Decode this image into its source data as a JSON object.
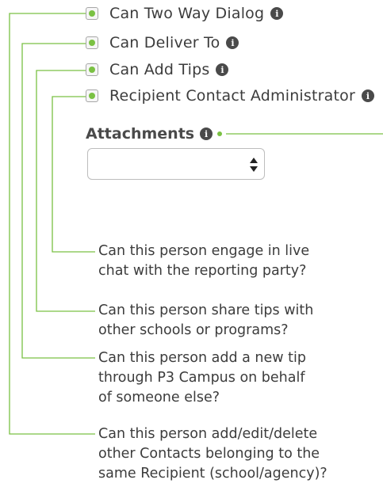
{
  "options": [
    {
      "label": "Can Two Way Dialog",
      "checked": true
    },
    {
      "label": "Can Deliver To",
      "checked": true
    },
    {
      "label": "Can Add Tips",
      "checked": true
    },
    {
      "label": "Recipient Contact Administrator",
      "checked": true
    }
  ],
  "attachments": {
    "label": "Attachments",
    "selected": ""
  },
  "notes": [
    {
      "lines": [
        "Can this person engage in live",
        "chat with the reporting party?"
      ]
    },
    {
      "lines": [
        "Can this person share tips with",
        "other schools or programs?"
      ]
    },
    {
      "lines": [
        "Can this person add a new tip",
        "through P3 Campus on behalf",
        "of someone else?"
      ]
    },
    {
      "lines": [
        "Can this person add/edit/delete",
        "other Contacts belonging to the",
        "same Recipient (school/agency)?"
      ]
    }
  ],
  "colors": {
    "accent": "#7ac143",
    "text": "#3c3c3c",
    "icon": "#4a4a4a"
  },
  "icons": {
    "info": "info-circle-icon",
    "select": "updown-arrows-icon"
  }
}
